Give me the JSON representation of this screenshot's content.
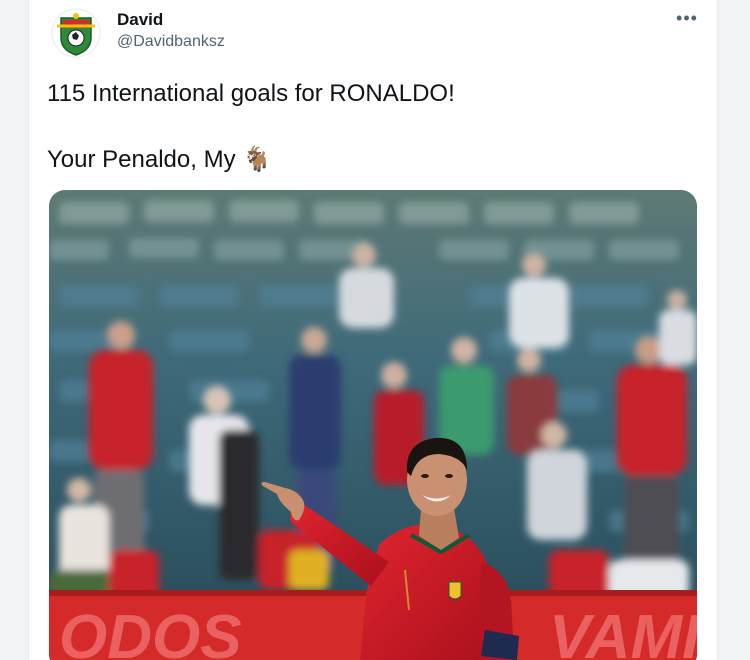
{
  "tweet": {
    "author_name": "David",
    "author_handle": "@Davidbanksz",
    "more_label": "•••",
    "text_line1": "115 International goals for RONALDO!",
    "text_line2_prefix": "Your Penaldo, My",
    "text_line2_emoji": "🐐",
    "avatar_icon": "soccer-club-crest-icon",
    "more_icon": "more-options-icon"
  },
  "media": {
    "banner_text_left": "ODOS",
    "banner_text_right": "VAMI",
    "colors": {
      "jersey_red": "#c8102e",
      "banner_red": "#d42a2a",
      "stand_teal": "#3a6e80"
    }
  }
}
